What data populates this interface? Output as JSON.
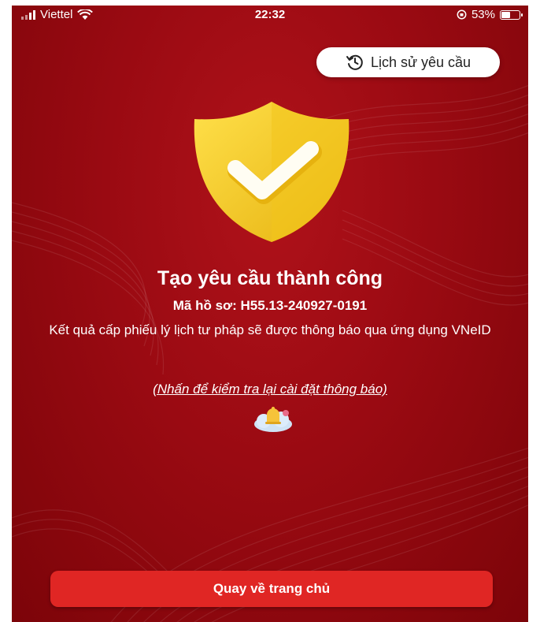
{
  "status_bar": {
    "carrier": "Viettel",
    "time": "22:32",
    "battery_percent": "53%",
    "battery_level": 0.53
  },
  "header": {
    "history_button_label": "Lịch sử yêu cầu",
    "history_icon": "history-clock-icon"
  },
  "result": {
    "icon": "shield-check-icon",
    "title": "Tạo yêu cầu thành công",
    "record_code": "Mã hồ sơ: H55.13-240927-0191",
    "description": "Kết quả cấp phiếu lý lịch tư pháp sẽ được thông báo qua ứng dụng VNeID",
    "notification_link": "(Nhấn để kiểm tra lại cài đặt thông báo)",
    "notification_icon": "bell-cloud-icon"
  },
  "footer": {
    "home_button_label": "Quay về trang chủ"
  },
  "colors": {
    "background": "#9a0a12",
    "primary_button": "#e02624",
    "shield": "#f4cf22",
    "text": "#ffffff"
  }
}
